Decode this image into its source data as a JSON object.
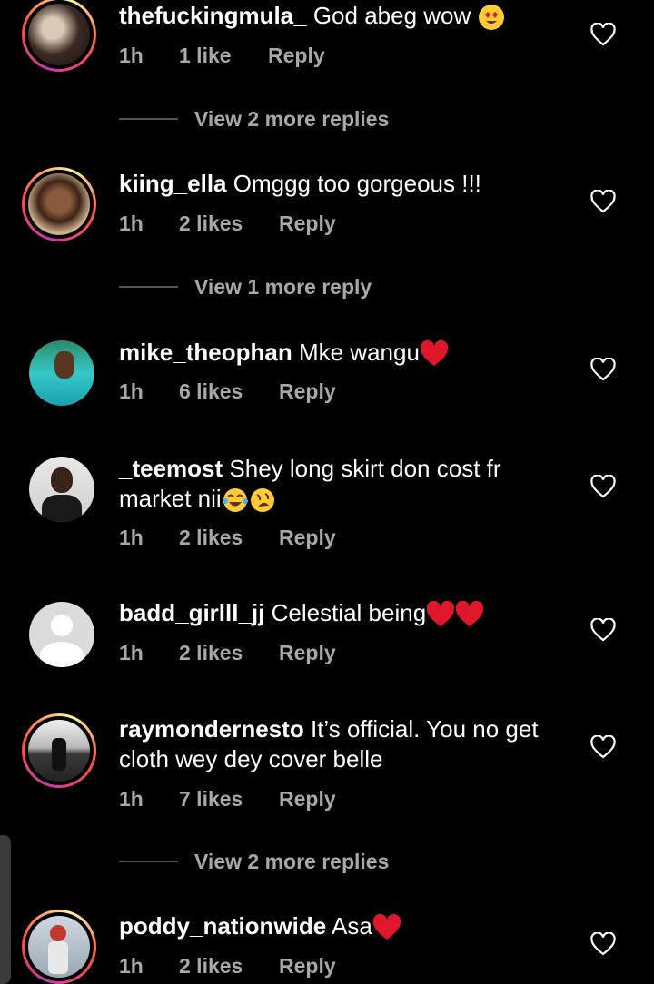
{
  "comments": [
    {
      "username": "thefuckingmula_",
      "text": "God abeg wow",
      "time": "1h",
      "likes": "1 like",
      "reply": "Reply"
    },
    {
      "username": "kiing_ella",
      "text": "Omggg too gorgeous !!!",
      "time": "1h",
      "likes": "2 likes",
      "reply": "Reply"
    },
    {
      "username": "mike_theophan",
      "text": "Mke wangu",
      "time": "1h",
      "likes": "6 likes",
      "reply": "Reply"
    },
    {
      "username": "_teemost",
      "text": "Shey long skirt don cost fr market nii",
      "time": "1h",
      "likes": "2 likes",
      "reply": "Reply"
    },
    {
      "username": "badd_girlll_jj",
      "text": "Celestial being",
      "time": "1h",
      "likes": "2 likes",
      "reply": "Reply"
    },
    {
      "username": "raymondernesto",
      "text": "It’s official. You no get cloth wey dey cover belle",
      "time": "1h",
      "likes": "7 likes",
      "reply": "Reply"
    },
    {
      "username": "poddy_nationwide",
      "text": "Asa",
      "time": "1h",
      "likes": "2 likes",
      "reply": "Reply"
    }
  ],
  "view_more": [
    {
      "label": "View 2 more replies"
    },
    {
      "label": "View 1 more reply"
    },
    {
      "label": "View 2 more replies"
    }
  ],
  "colors": {
    "background": "#000000",
    "meta": "#a8a8a8",
    "heart_emoji": "#e0162b",
    "ring_start": "#c837ab",
    "ring_end": "#fdf497"
  },
  "icons": {
    "like": "heart-outline-icon",
    "emoji_heart": "red-heart-emoji",
    "emoji_love": "heart-eyes-emoji",
    "emoji_laugh": "tears-of-joy-emoji",
    "emoji_rofl": "rolling-laughing-emoji"
  }
}
